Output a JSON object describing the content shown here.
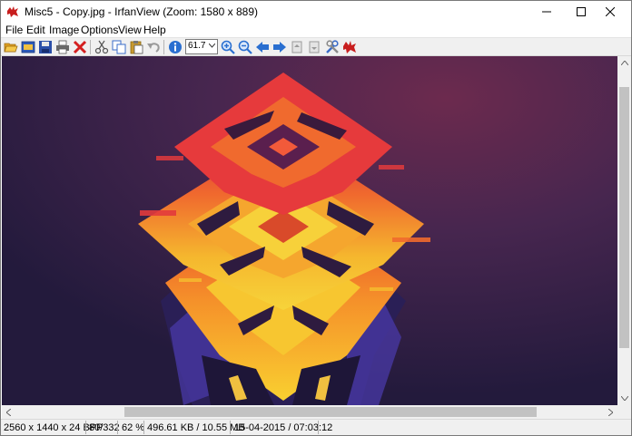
{
  "window": {
    "title": "Misc5 - Copy.jpg - IrfanView (Zoom: 1580 x 889)"
  },
  "menu": [
    "File",
    "Edit",
    "Image",
    "Options",
    "View",
    "Help"
  ],
  "toolbar": {
    "buttons": [
      {
        "name": "open-icon",
        "color": "#e0a020"
      },
      {
        "name": "slideshow-icon",
        "color": "#3a6cc8"
      },
      {
        "name": "save-icon",
        "color": "#2b4fa8"
      },
      {
        "name": "print-icon",
        "color": "#5a5a5a"
      },
      {
        "name": "delete-icon",
        "color": "#d42020"
      },
      {
        "name": "cut-icon",
        "color": "#7a7a7a"
      },
      {
        "name": "copy-icon",
        "color": "#3a6cc8"
      },
      {
        "name": "paste-icon",
        "color": "#c89a30"
      },
      {
        "name": "undo-icon",
        "color": "#9a9a9a"
      },
      {
        "name": "info-icon",
        "color": "#2a6fd0"
      },
      {
        "name": "zoom-in-icon",
        "color": "#2a6fd0"
      },
      {
        "name": "zoom-out-icon",
        "color": "#2a6fd0"
      },
      {
        "name": "previous-icon",
        "color": "#2a6fd0"
      },
      {
        "name": "next-icon",
        "color": "#2a6fd0"
      },
      {
        "name": "first-page-icon",
        "color": "#9a9a9a"
      },
      {
        "name": "last-page-icon",
        "color": "#9a9a9a"
      },
      {
        "name": "settings-icon",
        "color": "#3a6cc8"
      },
      {
        "name": "irfanview-cat-icon",
        "color": "#c81e1e"
      }
    ],
    "zoom_value": "61.7"
  },
  "statusbar": {
    "dimensions": "2560 x 1440 x 24 BPP",
    "file_index": "80/332",
    "zoom_percent": "62 %",
    "file_size": "496.61 KB / 10.55 MB",
    "datetime": "15-04-2015 / 07:03:12"
  },
  "colors": {
    "image_bg": "#3a2448",
    "accent_red": "#e8402a",
    "accent_orange": "#f5812a",
    "accent_yellow": "#f8d030"
  }
}
